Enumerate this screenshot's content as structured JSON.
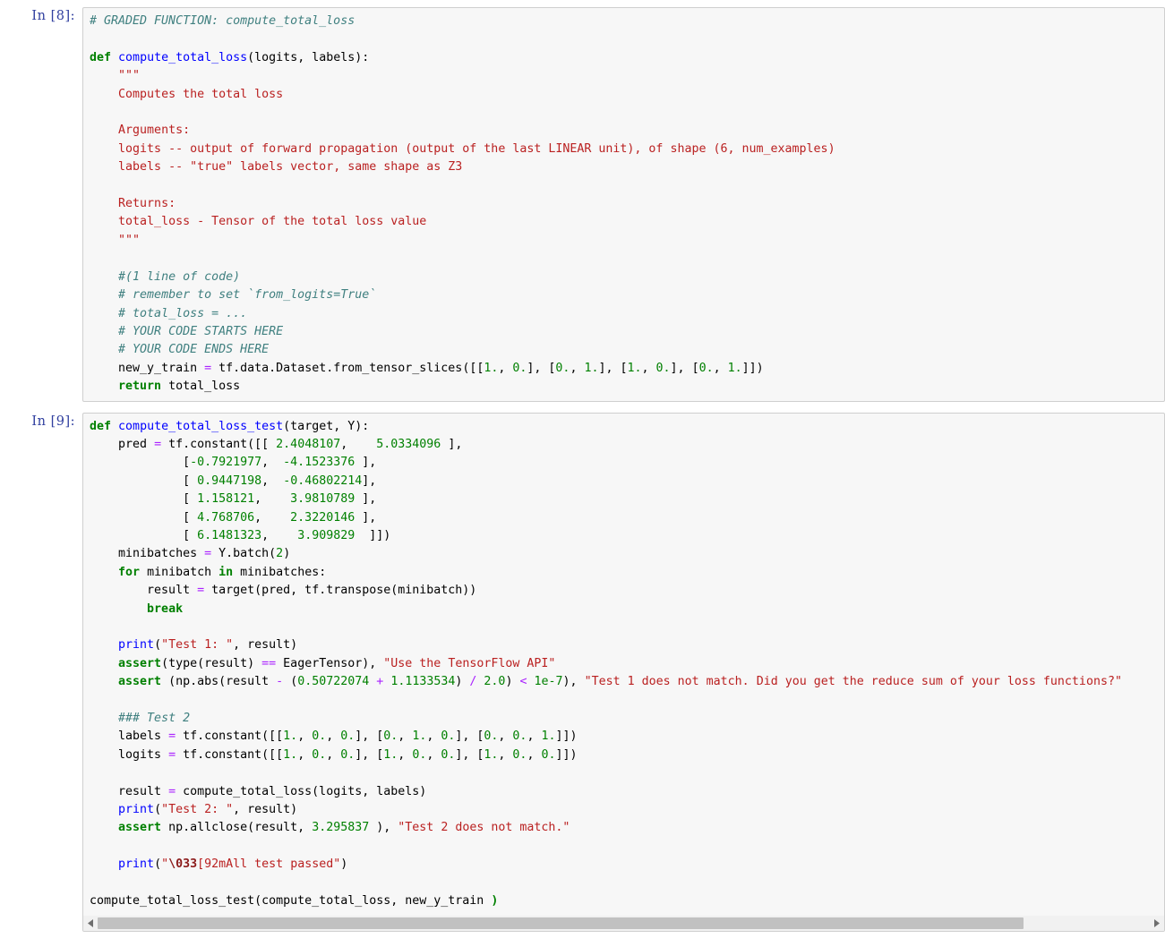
{
  "notebook": {
    "cells": [
      {
        "prompt": "In [8]:",
        "execution_count": 8,
        "type": "code",
        "source": "# GRADED FUNCTION: compute_total_loss\n\ndef compute_total_loss(logits, labels):\n    \"\"\"\n    Computes the total loss\n    \n    Arguments:\n    logits -- output of forward propagation (output of the last LINEAR unit), of shape (6, num_examples)\n    labels -- \"true\" labels vector, same shape as Z3\n    \n    Returns:\n    total_loss - Tensor of the total loss value\n    \"\"\"\n    \n    #(1 line of code)\n    # remember to set `from_logits=True`\n    # total_loss = ...\n    # YOUR CODE STARTS HERE\n    # YOUR CODE ENDS HERE\n    new_y_train = tf.data.Dataset.from_tensor_slices([[1., 0.], [0., 1.], [1., 0.], [0., 1.]])\n    return total_loss"
      },
      {
        "prompt": "In [9]:",
        "execution_count": 9,
        "type": "code",
        "source": "def compute_total_loss_test(target, Y):\n    pred = tf.constant([[ 2.4048107,   5.0334096 ],\n             [-0.7921977,  -4.1523376 ],\n             [ 0.9447198,  -0.46802214],\n             [ 1.158121,    3.9810789 ],\n             [ 4.768706,    2.3220146 ],\n             [ 6.1481323,   3.909829  ]])\n    minibatches = Y.batch(2)\n    for minibatch in minibatches:\n        result = target(pred, tf.transpose(minibatch))\n        break\n        \n    print(\"Test 1: \", result)\n    assert(type(result) == EagerTensor), \"Use the TensorFlow API\"\n    assert (np.abs(result - (0.50722074 + 1.1133534) / 2.0) < 1e-7), \"Test 1 does not match. Did you get the reduce sum of your loss functions?\"\n    \n    ### Test 2\n    labels = tf.constant([[1., 0., 0.], [0., 1., 0.], [0., 0., 1.]])\n    logits = tf.constant([[1., 0., 0.], [1., 0., 0.], [1., 0., 0.]])\n    \n    result = compute_total_loss(logits, labels)\n    print(\"Test 2: \", result)\n    assert np.allclose(result, 3.295837 ), \"Test 2 does not match.\"\n    \n    print(\"\\033[92mAll test passed\")\n\ncompute_total_loss_test(compute_total_loss, new_y_train )"
      }
    ]
  },
  "cell1_lines": {
    "l1": "# GRADED FUNCTION: compute_total_loss",
    "l3_kw": "def",
    "l3_name": "compute_total_loss",
    "l3_args": "(logits, labels):",
    "l4": "\"\"\"",
    "l5": "Computes the total loss",
    "l7": "Arguments:",
    "l8": "logits -- output of forward propagation (output of the last LINEAR unit), of shape (6, num_examples)",
    "l9": "labels -- \"true\" labels vector, same shape as Z3",
    "l11": "Returns:",
    "l12": "total_loss - Tensor of the total loss value",
    "l13": "\"\"\"",
    "l15": "#(1 line of code)",
    "l16": "# remember to set `from_logits=True`",
    "l17": "# total_loss = ...",
    "l18": "# YOUR CODE STARTS HERE",
    "l19": "# YOUR CODE ENDS HERE",
    "l20_var": "new_y_train ",
    "l20_eq": "=",
    "l20_call": " tf.data.Dataset.from_tensor_slices([[",
    "l20_n1": "1.",
    "l20_s1": ", ",
    "l20_n2": "0.",
    "l20_s2": "], [",
    "l20_n3": "0.",
    "l20_s3": ", ",
    "l20_n4": "1.",
    "l20_s4": "], [",
    "l20_n5": "1.",
    "l20_s5": ", ",
    "l20_n6": "0.",
    "l20_s6": "], [",
    "l20_n7": "0.",
    "l20_s7": ", ",
    "l20_n8": "1.",
    "l20_s8": "]])",
    "l21_kw": "return",
    "l21_rest": " total_loss"
  },
  "cell2_lines": {
    "def_kw": "def",
    "def_name": "compute_total_loss_test",
    "def_args": "(target, Y):",
    "pred_var": "    pred ",
    "pred_eq": "=",
    "pred_call": " tf.constant([[ ",
    "pred_r1c1": "2.4048107",
    "pred_r1c2": "5.0334096",
    "pred_r2c1": "-0.7921977",
    "pred_r2c2": "-4.1523376",
    "pred_r3c1": "0.9447198",
    "pred_r3c2": "-0.46802214",
    "pred_r4c1": "1.158121",
    "pred_r4c2": "3.9810789",
    "pred_r5c1": "4.768706",
    "pred_r5c2": "2.3220146",
    "pred_r6c1": "6.1481323",
    "pred_r6c2": "3.909829",
    "mb_var": "    minibatches ",
    "mb_eq": "=",
    "mb_rest": " Y.batch(",
    "mb_num": "2",
    "mb_end": ")",
    "for_kw": "for",
    "for_mid": " minibatch ",
    "in_kw": "in",
    "for_end": " minibatches:",
    "res_var": "        result ",
    "res_eq": "=",
    "res_rest": " target(pred, tf.transpose(minibatch))",
    "break_kw": "break",
    "print1_fn": "    print",
    "print1_p1": "(",
    "print1_str": "\"Test 1: \"",
    "print1_end": ", result)",
    "assert1_kw": "assert",
    "assert1_mid": "(type(result) ",
    "assert1_op": "==",
    "assert1_mid2": " EagerTensor), ",
    "assert1_str": "\"Use the TensorFlow API\"",
    "assert2_kw": "assert",
    "assert2_a": " (np.abs(result ",
    "assert2_op1": "-",
    "assert2_b": " (",
    "assert2_n1": "0.50722074",
    "assert2_op2": "+",
    "assert2_n2": "1.1133534",
    "assert2_c": ") ",
    "assert2_op3": "/",
    "assert2_n3": "2.0",
    "assert2_d": ") ",
    "assert2_op4": "<",
    "assert2_n4": "1e-7",
    "assert2_e": "), ",
    "assert2_str": "\"Test 1 does not match. Did you get the reduce sum of your loss functions?\"",
    "test2_comment": "### Test 2",
    "labels_var": "    labels ",
    "labels_eq": "=",
    "labels_call": " tf.constant([[",
    "logits_var": "    logits ",
    "logits_eq": "=",
    "logits_call": " tf.constant([[",
    "labels_vals": [
      "1.",
      "0.",
      "0.",
      "0.",
      "1.",
      "0.",
      "0.",
      "0.",
      "1."
    ],
    "logits_vals": [
      "1.",
      "0.",
      "0.",
      "1.",
      "0.",
      "0.",
      "1.",
      "0.",
      "0."
    ],
    "result2_var": "    result ",
    "result2_eq": "=",
    "result2_rest": " compute_total_loss(logits, labels)",
    "print2_fn": "    print",
    "print2_str": "\"Test 2: \"",
    "print2_end": ", result)",
    "assert3_kw": "assert",
    "assert3_mid": " np.allclose(result, ",
    "assert3_num": "3.295837",
    "assert3_mid2": " ), ",
    "assert3_str": "\"Test 2 does not match.\"",
    "print3_fn": "    print",
    "print3_quote": "\"",
    "print3_esc": "\\033",
    "print3_rest": "[92mAll test passed\"",
    "print3_end": ")",
    "final_call_name": "compute_total_loss_test",
    "final_call_args_open": "(",
    "final_call_inner": "compute_total_loss, new_y_train ",
    "final_call_close": ")"
  },
  "scrollbar": {
    "left_arrow": "scroll-left",
    "right_arrow": "scroll-right",
    "thumb_fraction_percent": 88
  },
  "colors": {
    "comment": "#408080",
    "keyword": "#008000",
    "function_name": "#0000FF",
    "string": "#BA2121",
    "string_escape": "#8b1a1a",
    "operator": "#AA22FF",
    "number": "#008000",
    "prompt": "#303F9F",
    "cell_background": "#f7f7f7",
    "cell_border": "#cfcfcf",
    "scrollbar_thumb": "#c1c1c1"
  }
}
